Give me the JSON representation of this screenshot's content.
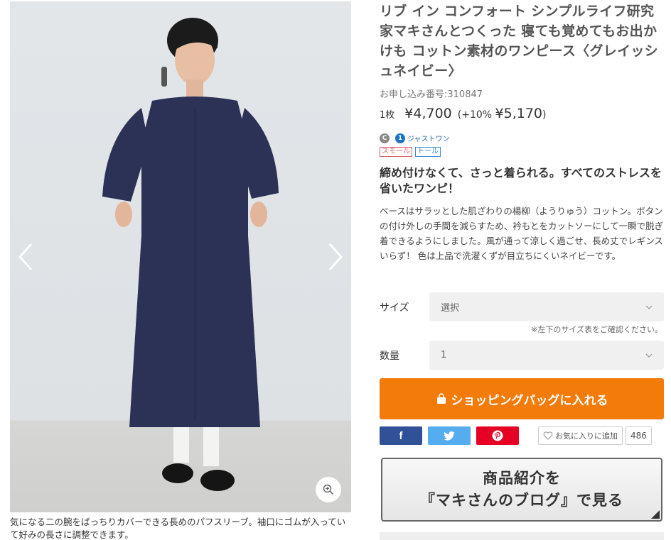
{
  "gallery": {
    "prev_icon": "chevron-left-icon",
    "next_icon": "chevron-right-icon",
    "zoom_icon": "zoom-in-icon",
    "caption": "気になる二の腕をばっちりカバーできる長めのパフスリーブ。袖口にゴムが入っていて好みの長さに調整できます。"
  },
  "product": {
    "title": "リブ イン コンフォート シンプルライフ研究家マキさんとつくった 寝ても覚めてもお出かけも コットン素材のワンピース〈グレイッシュネイビー〉",
    "order_no": "お申し込み番号:310847",
    "unit": "1枚",
    "price": "¥4,700",
    "tax_prefix": "(+10% ",
    "tax_price": "¥5,170",
    "tax_suffix": ")",
    "brand_c": "C",
    "brand_justone_mark": "1",
    "brand_justone": "ジャストワン",
    "tags": [
      "スモール",
      "トール"
    ],
    "headline": "締め付けなくて、さっと着られる。すべてのストレスを省いたワンピ！",
    "description": "ベースはサラッとした肌ざわりの楊柳（ようりゅう）コットン。ボタンの付け外しの手間を減らすため、衿もとをカットソーにして一瞬で脱ぎ着できるようにしました。風が通って涼しく過ごせ、長め丈でレギンスいらず！ 色は上品で洗濯くずが目立ちにくいネイビーです。"
  },
  "form": {
    "size_label": "サイズ",
    "size_value": "選択",
    "size_note": "※左下のサイズ表をご確認ください。",
    "qty_label": "数量",
    "qty_value": "1",
    "cart_label": "ショッピングバッグに入れる"
  },
  "social": {
    "facebook_icon": "f",
    "twitter_icon": "twitter-bird-icon",
    "pinterest_icon": "pinterest-icon",
    "favorite_label": "お気に入りに追加",
    "favorite_count": "486"
  },
  "blog": {
    "line1": "商品紹介を",
    "line2": "『マキさんのブログ』で見る"
  },
  "colors": {
    "cart": "#f27b09",
    "facebook": "#305097",
    "twitter": "#55acee",
    "pinterest": "#e60023",
    "dress": "#2b3256"
  }
}
